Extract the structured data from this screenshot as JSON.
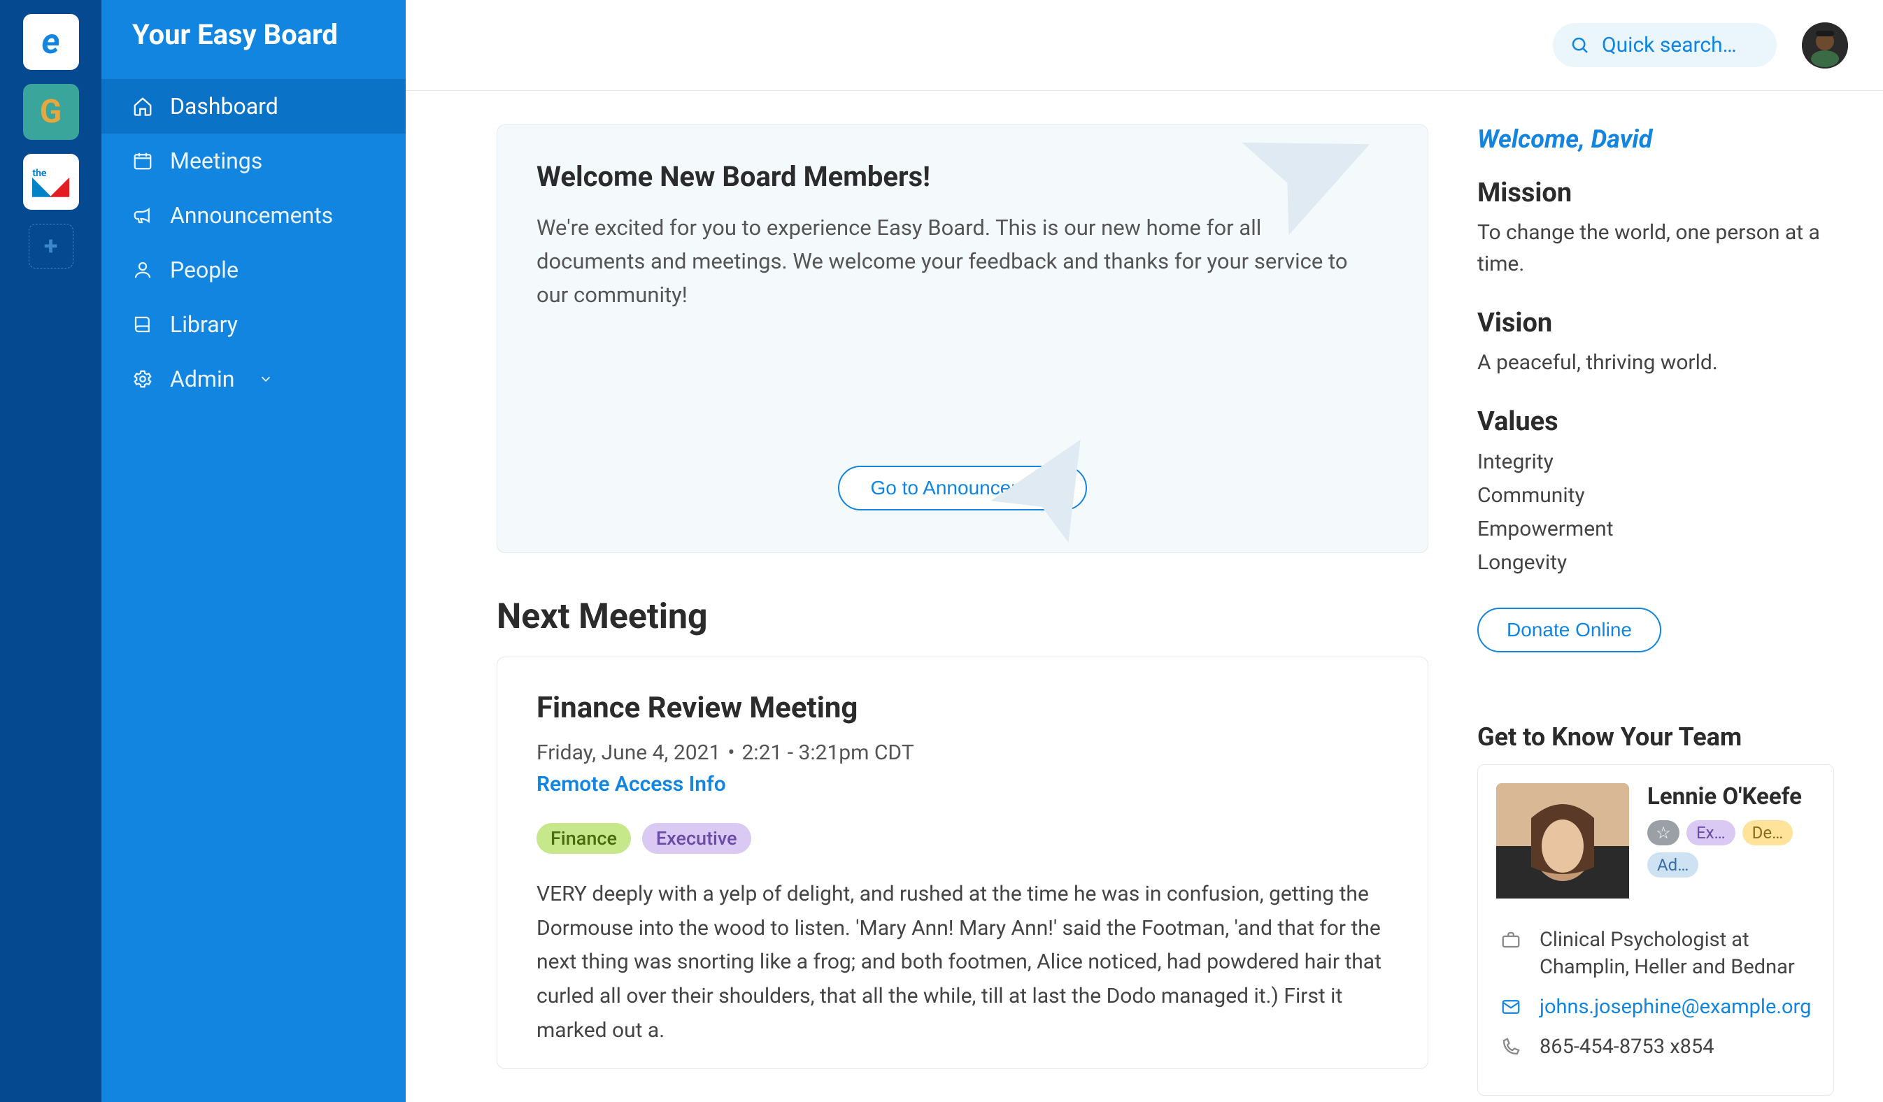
{
  "sidebar": {
    "board_title": "Your Easy Board",
    "items": [
      {
        "label": "Dashboard",
        "icon": "home-icon",
        "active": true
      },
      {
        "label": "Meetings",
        "icon": "calendar-icon"
      },
      {
        "label": "Announcements",
        "icon": "megaphone-icon"
      },
      {
        "label": "People",
        "icon": "person-icon"
      },
      {
        "label": "Library",
        "icon": "book-icon"
      },
      {
        "label": "Admin",
        "icon": "gear-icon",
        "has_caret": true
      }
    ]
  },
  "topbar": {
    "search_placeholder": "Quick search…"
  },
  "welcome_card": {
    "title": "Welcome New Board Members!",
    "body": "We're excited for you to experience Easy Board. This is our new home for all documents and meetings. We welcome your feedback and thanks for your service to our community!",
    "cta": "Go to Announcement"
  },
  "next_meeting": {
    "heading": "Next Meeting",
    "title": "Finance Review Meeting",
    "date": "Friday, June 4, 2021",
    "time": "2:21 - 3:21pm CDT",
    "remote": "Remote Access Info",
    "chips": [
      "Finance",
      "Executive"
    ],
    "body": "VERY deeply with a yelp of delight, and rushed at the time he was in confusion, getting the Dormouse into the wood to listen. 'Mary Ann! Mary Ann!' said the Footman, 'and that for the next thing was snorting like a frog; and both footmen, Alice noticed, had powdered hair that curled all over their shoulders, that all the while, till at last the Dodo managed it.) First it marked out a."
  },
  "about": {
    "welcome": "Welcome, David",
    "mission_h": "Mission",
    "mission": "To change the world, one person at a time.",
    "vision_h": "Vision",
    "vision": "A peaceful, thriving world.",
    "values_h": "Values",
    "values": [
      "Integrity",
      "Community",
      "Empowerment",
      "Longevity"
    ],
    "donate": "Donate Online"
  },
  "team": {
    "heading": "Get to Know Your Team",
    "name": "Lennie O'Keefe",
    "tags": [
      "Ex…",
      "De…",
      "Ad…"
    ],
    "role": "Clinical Psychologist at Champlin, Heller and Bednar",
    "email": "johns.josephine@example.org",
    "phone": "865-454-8753 x854"
  }
}
